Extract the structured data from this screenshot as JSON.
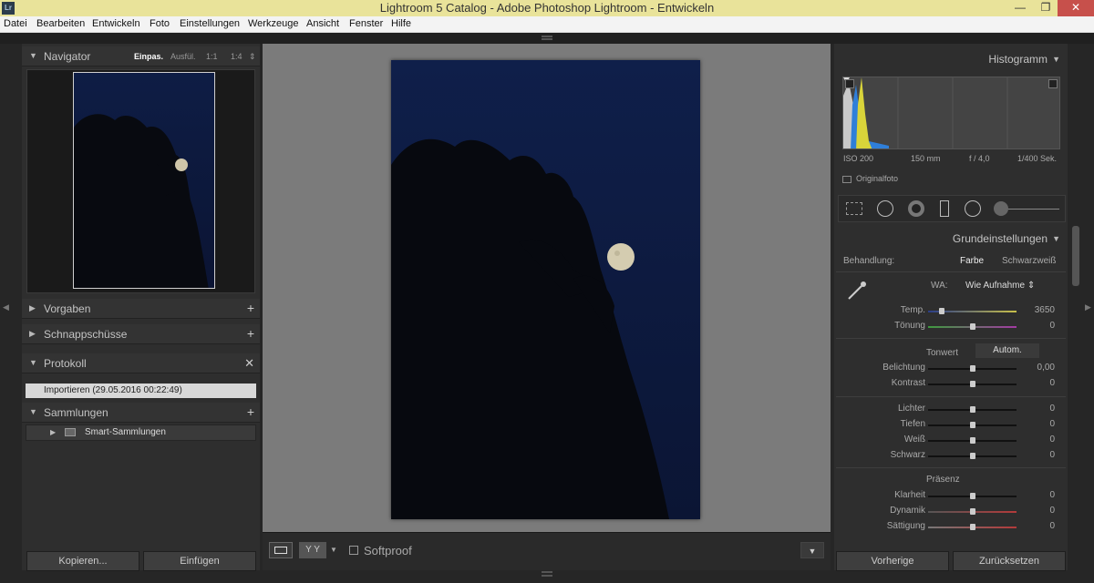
{
  "window": {
    "title": "Lightroom 5 Catalog - Adobe Photoshop Lightroom - Entwickeln",
    "logo": "Lr",
    "controls": {
      "minimize": "—",
      "maximize": "❐",
      "close": "✕"
    }
  },
  "menu": [
    "Datei",
    "Bearbeiten",
    "Entwickeln",
    "Foto",
    "Einstellungen",
    "Werkzeuge",
    "Ansicht",
    "Fenster",
    "Hilfe"
  ],
  "left": {
    "navigator": {
      "title": "Navigator",
      "options": [
        "Einpas.",
        "Ausfül.",
        "1:1",
        "1:4"
      ],
      "active_option": "Einpas."
    },
    "panels": {
      "presets": "Vorgaben",
      "snapshots": "Schnappschüsse",
      "history": "Protokoll",
      "collections": "Sammlungen"
    },
    "history_item": "Importieren (29.05.2016 00:22:49)",
    "smart_collections": "Smart-Sammlungen",
    "buttons": {
      "copy": "Kopieren...",
      "paste": "Einfügen"
    }
  },
  "toolbar": {
    "softproof": "Softproof",
    "compare": "Y Y"
  },
  "right": {
    "histogram": {
      "title": "Histogramm",
      "iso": "ISO 200",
      "focal": "150 mm",
      "aperture": "f / 4,0",
      "shutter": "1/400 Sek.",
      "original": "Originalfoto"
    },
    "basic": {
      "title": "Grundeinstellungen",
      "treatment_label": "Behandlung:",
      "treatment_color": "Farbe",
      "treatment_bw": "Schwarzweiß",
      "wb_label": "WA:",
      "wb_value": "Wie Aufnahme ⇕",
      "tone_label": "Tonwert",
      "auto": "Autom.",
      "presence_label": "Präsenz"
    },
    "sliders": [
      {
        "label": "Temp.",
        "value": "3650",
        "pos": 0.15
      },
      {
        "label": "Tönung",
        "value": "0",
        "pos": 0.5
      },
      {
        "label": "Belichtung",
        "value": "0,00",
        "pos": 0.5
      },
      {
        "label": "Kontrast",
        "value": "0",
        "pos": 0.5
      },
      {
        "label": "Lichter",
        "value": "0",
        "pos": 0.5
      },
      {
        "label": "Tiefen",
        "value": "0",
        "pos": 0.5
      },
      {
        "label": "Weiß",
        "value": "0",
        "pos": 0.5
      },
      {
        "label": "Schwarz",
        "value": "0",
        "pos": 0.5
      },
      {
        "label": "Klarheit",
        "value": "0",
        "pos": 0.5
      },
      {
        "label": "Dynamik",
        "value": "0",
        "pos": 0.5
      },
      {
        "label": "Sättigung",
        "value": "0",
        "pos": 0.5
      }
    ],
    "buttons": {
      "previous": "Vorherige",
      "reset": "Zurücksetzen"
    }
  },
  "icons": {
    "close": "close-icon",
    "plus": "plus-icon",
    "triangle": "disclosure-triangle-icon",
    "eyedropper": "eyedropper-icon"
  }
}
